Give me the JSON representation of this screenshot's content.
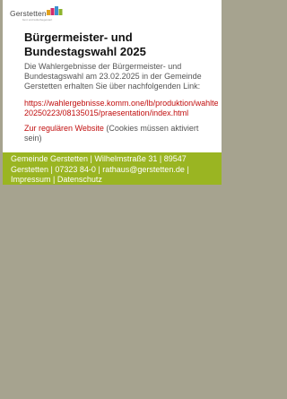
{
  "logo": {
    "name": "Gerstetten",
    "tagline": "bunt und kulturbegeistert"
  },
  "colors": {
    "background": "#a6a38f",
    "accent": "#9ab522",
    "link": "#c10e0e"
  },
  "main": {
    "title_line1": "Bürgermeister- und",
    "title_line2": "Bundestagswahl 2025",
    "intro": "Die Wahlergebnisse der Bürgermeister- und Bundestagswahl am 23.02.2025 in der Gemeinde Gerstetten erhalten Sie über nachfolgenden Link:",
    "results_link_line1": "https://wahlergebnisse.komm.one/lb/produktion/wahltermin-",
    "results_link_line2": "20250223/08135015/praesentation/index.html",
    "fallback_link": "Zur regulären Website",
    "fallback_note": " (Cookies müssen aktiviert sein)"
  },
  "footer": {
    "address": "Gemeinde Gerstetten | Wilhelmstraße 31 | 89547 Gerstetten | 07323 84-0 | ",
    "email": "rathaus@gerstetten.de",
    "separator1": " | ",
    "impressum": "Impressum",
    "separator2": " | ",
    "datenschutz": "Datenschutz"
  }
}
